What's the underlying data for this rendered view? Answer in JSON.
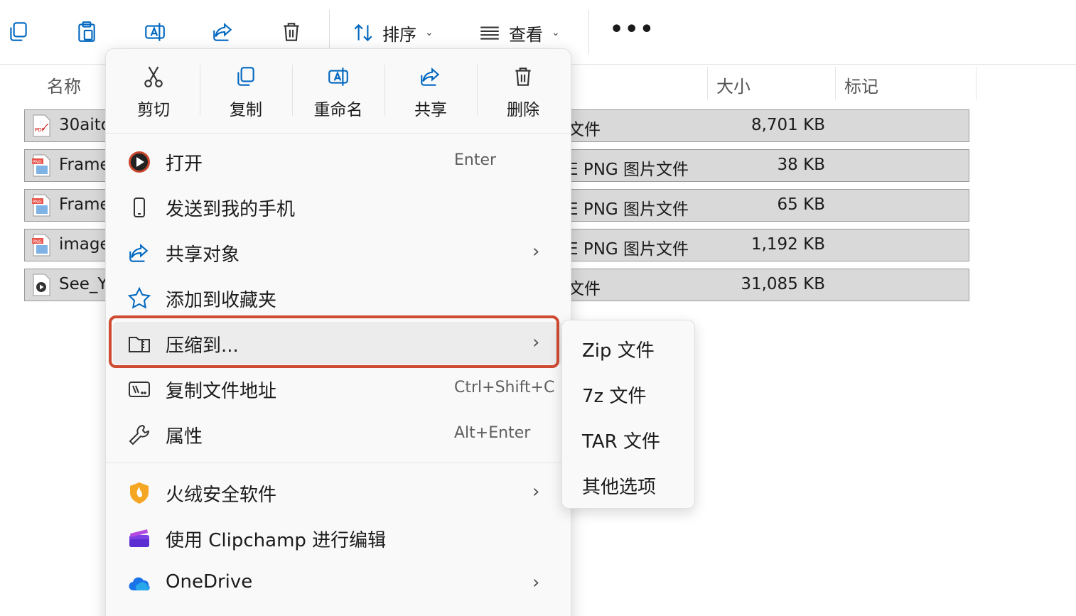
{
  "toolbar": {
    "sort_label": "排序",
    "view_label": "查看",
    "more_label": "•••"
  },
  "columns": {
    "name": "名称",
    "size": "大小",
    "tags": "标记"
  },
  "files": [
    {
      "name": "30aito",
      "type": "文件",
      "size": "8,701 KB",
      "icon": "pdf-file-icon"
    },
    {
      "name": "Frame",
      "type": "E PNG 图片文件",
      "size": "38 KB",
      "icon": "png-file-icon"
    },
    {
      "name": "Frame",
      "type": "E PNG 图片文件",
      "size": "65 KB",
      "icon": "png-file-icon"
    },
    {
      "name": "image",
      "type": "E PNG 图片文件",
      "size": "1,192 KB",
      "icon": "png-file-icon"
    },
    {
      "name": "See_Y",
      "type": "文件",
      "size": "31,085 KB",
      "icon": "video-file-icon"
    }
  ],
  "context_menu": {
    "quick_actions": [
      {
        "label": "剪切",
        "icon": "scissors-icon"
      },
      {
        "label": "复制",
        "icon": "copy-icon"
      },
      {
        "label": "重命名",
        "icon": "rename-icon"
      },
      {
        "label": "共享",
        "icon": "share-icon"
      },
      {
        "label": "删除",
        "icon": "trash-icon"
      }
    ],
    "items": [
      {
        "label": "打开",
        "shortcut": "Enter",
        "icon": "play-icon"
      },
      {
        "label": "发送到我的手机",
        "icon": "phone-icon"
      },
      {
        "label": "共享对象",
        "icon": "share-icon",
        "arrow": "›"
      },
      {
        "label": "添加到收藏夹",
        "icon": "star-icon"
      },
      {
        "label": "压缩到...",
        "icon": "zip-folder-icon",
        "arrow": "›"
      },
      {
        "label": "复制文件地址",
        "shortcut": "Ctrl+Shift+C",
        "icon": "path-icon"
      },
      {
        "label": "属性",
        "shortcut": "Alt+Enter",
        "icon": "wrench-icon"
      },
      {
        "label": "火绒安全软件",
        "icon": "huorong-shield-icon",
        "arrow": "›"
      },
      {
        "label": "使用 Clipchamp 进行编辑",
        "icon": "clipchamp-icon"
      },
      {
        "label": "OneDrive",
        "icon": "onedrive-cloud-icon",
        "arrow": "›"
      }
    ]
  },
  "submenu": {
    "items": [
      "Zip 文件",
      "7z 文件",
      "TAR 文件",
      "其他选项"
    ]
  },
  "colors": {
    "highlight_border": "#d04a32",
    "row_selected": "#d9d9d9",
    "accent": "#0067c0"
  }
}
